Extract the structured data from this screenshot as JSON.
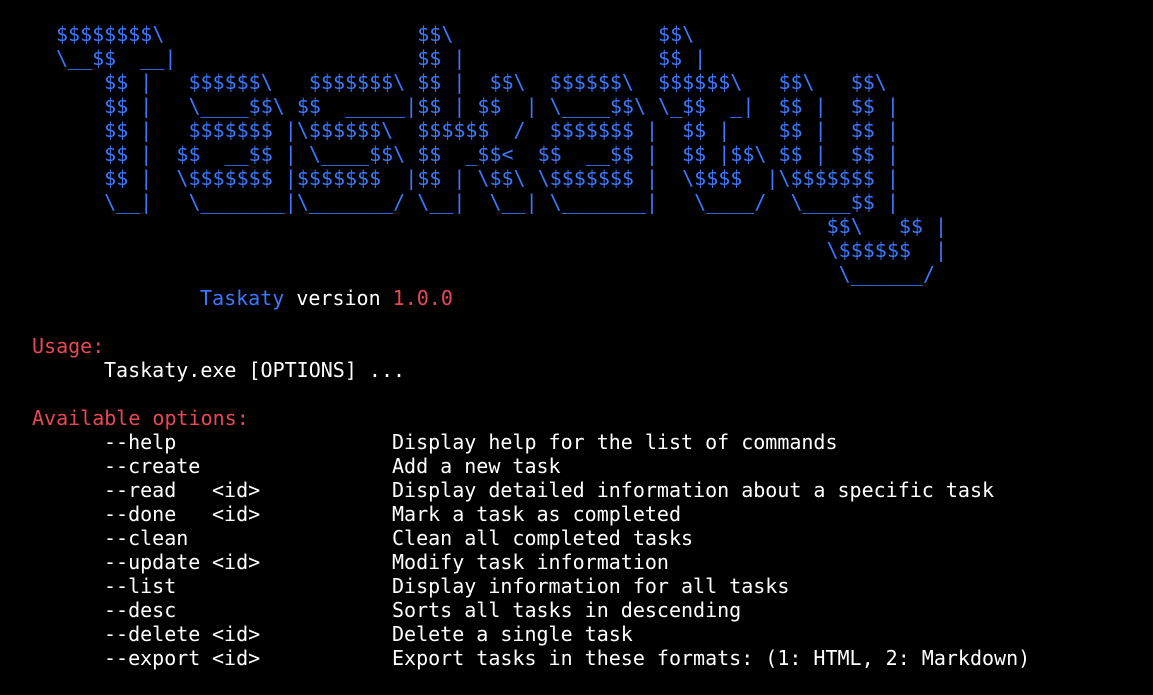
{
  "banner": {
    "lines": [
      "$$$$$$$$\\                     $$\\                 $$\\",
      "\\__$$  __|                    $$ |                $$ |",
      "    $$ |   $$$$$$\\   $$$$$$$\\ $$ |  $$\\  $$$$$$\\  $$$$$$\\   $$\\   $$\\",
      "    $$ |   \\____$$\\ $$  _____|$$ | $$  | \\____$$\\ \\_$$  _|  $$ |  $$ |",
      "    $$ |   $$$$$$$ |\\$$$$$$\\  $$$$$$  /  $$$$$$$ |  $$ |    $$ |  $$ |",
      "    $$ |  $$  __$$ | \\____$$\\ $$  _$$<  $$  __$$ |  $$ |$$\\ $$ |  $$ |",
      "    $$ |  \\$$$$$$$ |$$$$$$$  |$$ | \\$$\\ \\$$$$$$$ |  \\$$$$  |\\$$$$$$$ |",
      "    \\__|   \\_______|\\_______/ \\__|  \\__| \\_______|   \\____/  \\____$$ |",
      "                                                                $$\\   $$ |",
      "                                                                \\$$$$$$  |",
      "                                                                 \\______/"
    ]
  },
  "version": {
    "app_name": "Taskaty",
    "label": " version ",
    "number": "1.0.0"
  },
  "usage": {
    "title": "Usage:",
    "command": "Taskaty.exe [OPTIONS] ..."
  },
  "options": {
    "title": "Available options:",
    "items": [
      {
        "name": "--help",
        "arg": "",
        "desc": "Display help for the list of commands"
      },
      {
        "name": "--create",
        "arg": "",
        "desc": "Add a new task"
      },
      {
        "name": "--read",
        "arg": "<id>",
        "desc": "Display detailed information about a specific task"
      },
      {
        "name": "--done",
        "arg": "<id>",
        "desc": "Mark a task as completed"
      },
      {
        "name": "--clean",
        "arg": "",
        "desc": "Clean all completed tasks"
      },
      {
        "name": "--update",
        "arg": "<id>",
        "desc": "Modify task information"
      },
      {
        "name": "--list",
        "arg": "",
        "desc": "Display information for all tasks"
      },
      {
        "name": "--desc",
        "arg": "",
        "desc": "Sorts all tasks in descending"
      },
      {
        "name": "--delete",
        "arg": "<id>",
        "desc": "Delete a single task"
      },
      {
        "name": "--export",
        "arg": "<id>",
        "desc": "Export tasks in these formats: (1: HTML, 2: Markdown)"
      }
    ]
  },
  "colors": {
    "background": "#000000",
    "banner": "#3b78ff",
    "accent_red": "#e74856",
    "text": "#ffffff"
  }
}
